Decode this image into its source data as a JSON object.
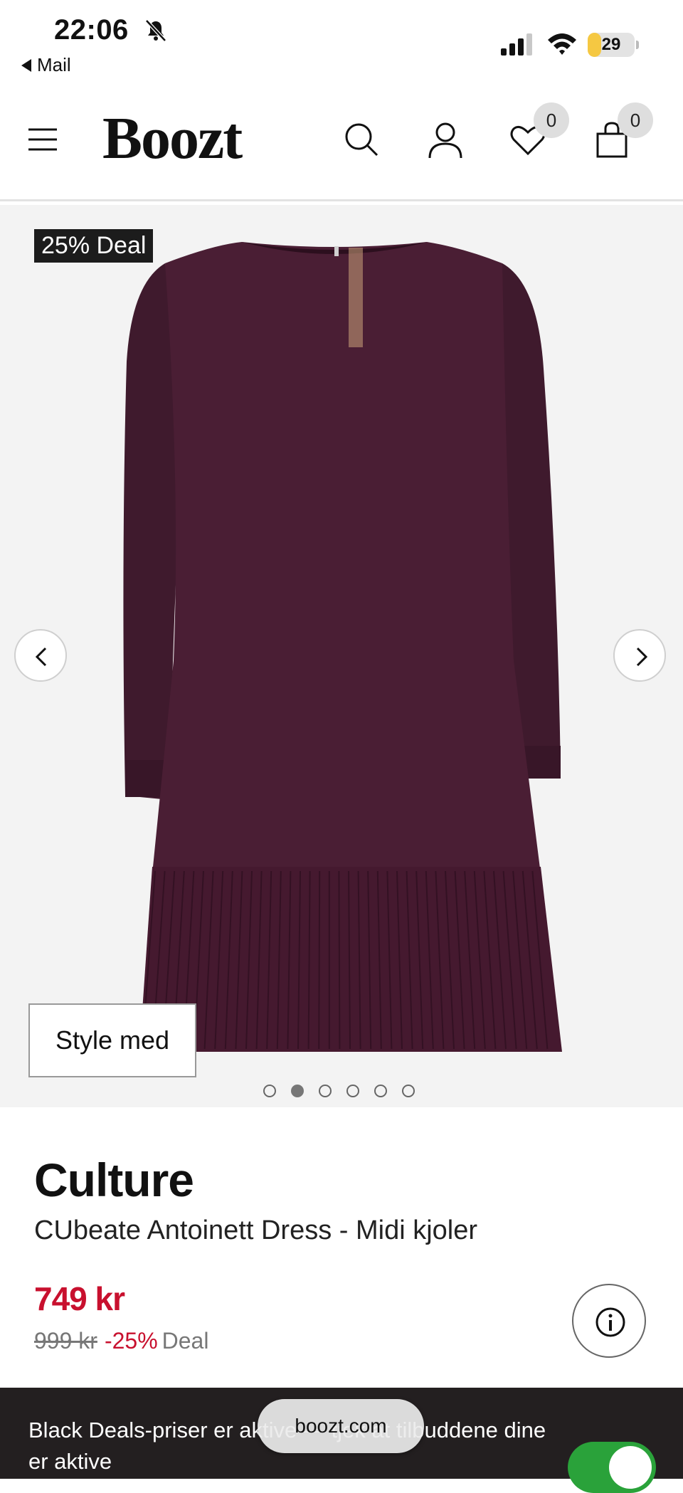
{
  "status_bar": {
    "time": "22:06",
    "back_app": "Mail",
    "battery": "29",
    "battery_level": 0.29
  },
  "header": {
    "logo": "Boozt",
    "wishlist_count": "0",
    "cart_count": "0"
  },
  "gallery": {
    "deal_tag": "25% Deal",
    "style_button": "Style med",
    "image_count": 6,
    "active_index": 1
  },
  "product": {
    "brand": "Culture",
    "name": "CUbeate Antoinett Dress - Midi kjoler",
    "price": "749 kr",
    "old_price": "999 kr",
    "discount": "-25%",
    "deal_label": "Deal"
  },
  "banner": {
    "text": "Black Deals-priser er aktive — tjek at tilbuddene dine er aktive",
    "url": "boozt.com",
    "toggle_on": true
  },
  "colors": {
    "accent_red": "#c8102e",
    "toggle_green": "#2aa23a",
    "banner_bg": "#231f20",
    "dress": "#4a1e34"
  }
}
